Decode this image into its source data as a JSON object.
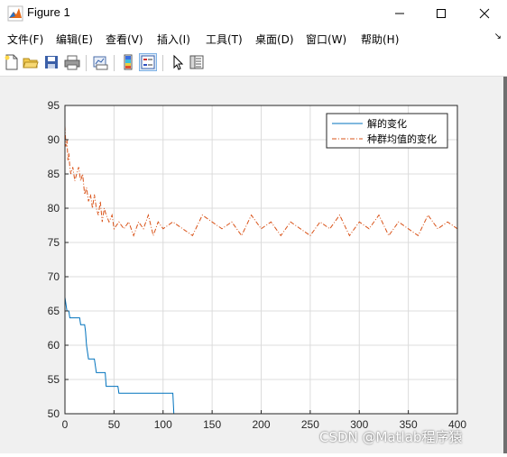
{
  "window": {
    "title": "Figure 1"
  },
  "menu": {
    "items": [
      "文件(F)",
      "编辑(E)",
      "查看(V)",
      "插入(I)",
      "工具(T)",
      "桌面(D)",
      "窗口(W)",
      "帮助(H)"
    ],
    "overflow": "↘"
  },
  "toolbar": {
    "icons": [
      "new-figure-icon",
      "open-file-icon",
      "save-icon",
      "print-icon",
      "link-plot-icon",
      "colorbar-icon",
      "legend-icon",
      "pointer-icon",
      "property-inspector-icon"
    ]
  },
  "watermark": "CSDN @Matlab程序猿",
  "chart_data": {
    "type": "line",
    "xlim": [
      0,
      400
    ],
    "ylim": [
      50,
      95
    ],
    "xticks": [
      0,
      50,
      100,
      150,
      200,
      250,
      300,
      350,
      400
    ],
    "yticks": [
      50,
      55,
      60,
      65,
      70,
      75,
      80,
      85,
      90,
      95
    ],
    "grid": true,
    "legend_position": "top-right",
    "series": [
      {
        "name": "解的变化",
        "color": "#0072bd",
        "style": "solid",
        "x": [
          0,
          1,
          2,
          4,
          5,
          9,
          10,
          15,
          16,
          20,
          21,
          22,
          24,
          30,
          31,
          32,
          33,
          41,
          42,
          54,
          55,
          110,
          111,
          400
        ],
        "y": [
          67,
          66,
          65,
          65,
          64,
          64,
          64,
          64,
          63,
          63,
          62,
          60,
          58,
          58,
          57,
          56,
          56,
          56,
          54,
          54,
          53,
          53,
          50,
          50
        ]
      },
      {
        "name": "种群均值的变化",
        "color": "#d95319",
        "style": "dashdot",
        "x": [
          0,
          1,
          2,
          3,
          4,
          5,
          6,
          8,
          10,
          12,
          14,
          16,
          18,
          20,
          22,
          24,
          26,
          28,
          30,
          32,
          34,
          36,
          38,
          40,
          42,
          45,
          48,
          50,
          55,
          60,
          65,
          70,
          75,
          80,
          85,
          90,
          95,
          100,
          110,
          120,
          130,
          140,
          150,
          160,
          170,
          180,
          190,
          200,
          210,
          220,
          230,
          240,
          250,
          260,
          270,
          280,
          290,
          300,
          310,
          320,
          330,
          340,
          350,
          360,
          370,
          380,
          390,
          400
        ],
        "y": [
          92,
          89,
          90,
          87,
          88,
          86,
          85,
          86,
          84,
          85,
          86,
          84,
          85,
          82,
          83,
          81,
          82,
          80,
          82,
          80,
          79,
          81,
          78,
          80,
          79,
          78,
          79,
          77,
          78,
          77,
          78,
          76,
          78,
          77,
          79,
          76,
          78,
          77,
          78,
          77,
          76,
          79,
          78,
          77,
          78,
          76,
          79,
          77,
          78,
          76,
          78,
          77,
          76,
          78,
          77,
          79,
          76,
          78,
          77,
          79,
          76,
          78,
          77,
          76,
          79,
          77,
          78,
          77
        ]
      }
    ]
  }
}
